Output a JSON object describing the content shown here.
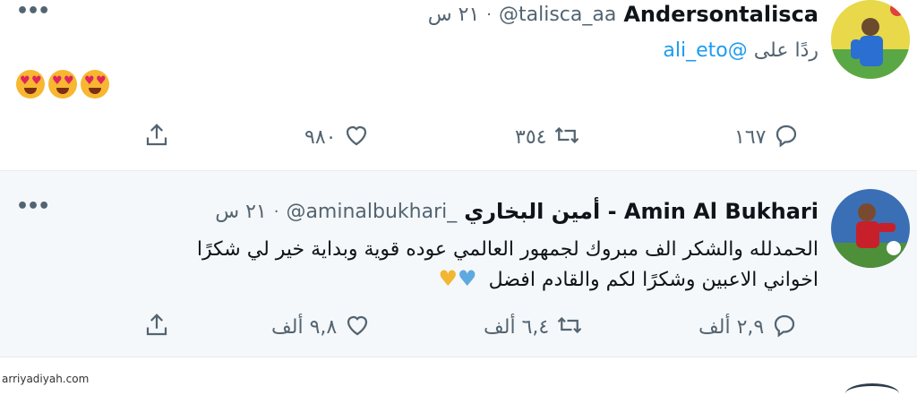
{
  "tweets": [
    {
      "display_name": "Andersontalisca",
      "handle": "@talisca_aa",
      "time": "٢١ س",
      "reply_to_prefix": "ردًا على",
      "reply_to_handle": "@ali_eto",
      "content": "",
      "emoji": [
        "smiling-face-with-heart-eyes",
        "smiling-face-with-heart-eyes",
        "smiling-face-with-heart-eyes"
      ],
      "stats": {
        "replies": "١٦٧",
        "retweets": "٣٥٤",
        "likes": "٩٨٠"
      }
    },
    {
      "display_name": "أمين البخاري - Amin Al Bukhari",
      "handle": "@aminalbukhari_",
      "time": "٢١ س",
      "content_line1": "الحمدلله والشكر الف مبروك لجمهور العالمي عوده قوية وبداية خير لي شكرًا",
      "content_line2": "اخواني الاعبين وشكرًا لكم والقادم افضل",
      "emoji": [
        "blue-heart",
        "yellow-heart"
      ],
      "stats": {
        "replies": "٢,٩ ألف",
        "retweets": "٦,٤ ألف",
        "likes": "٩,٨ ألف"
      }
    }
  ],
  "more_glyph": "•••",
  "dot_glyph": "·",
  "watermark": "arriyadiyah.com",
  "colors": {
    "link": "#1d9bf0",
    "secondary": "#536471",
    "highlight_bg": "#f5f8fa"
  }
}
